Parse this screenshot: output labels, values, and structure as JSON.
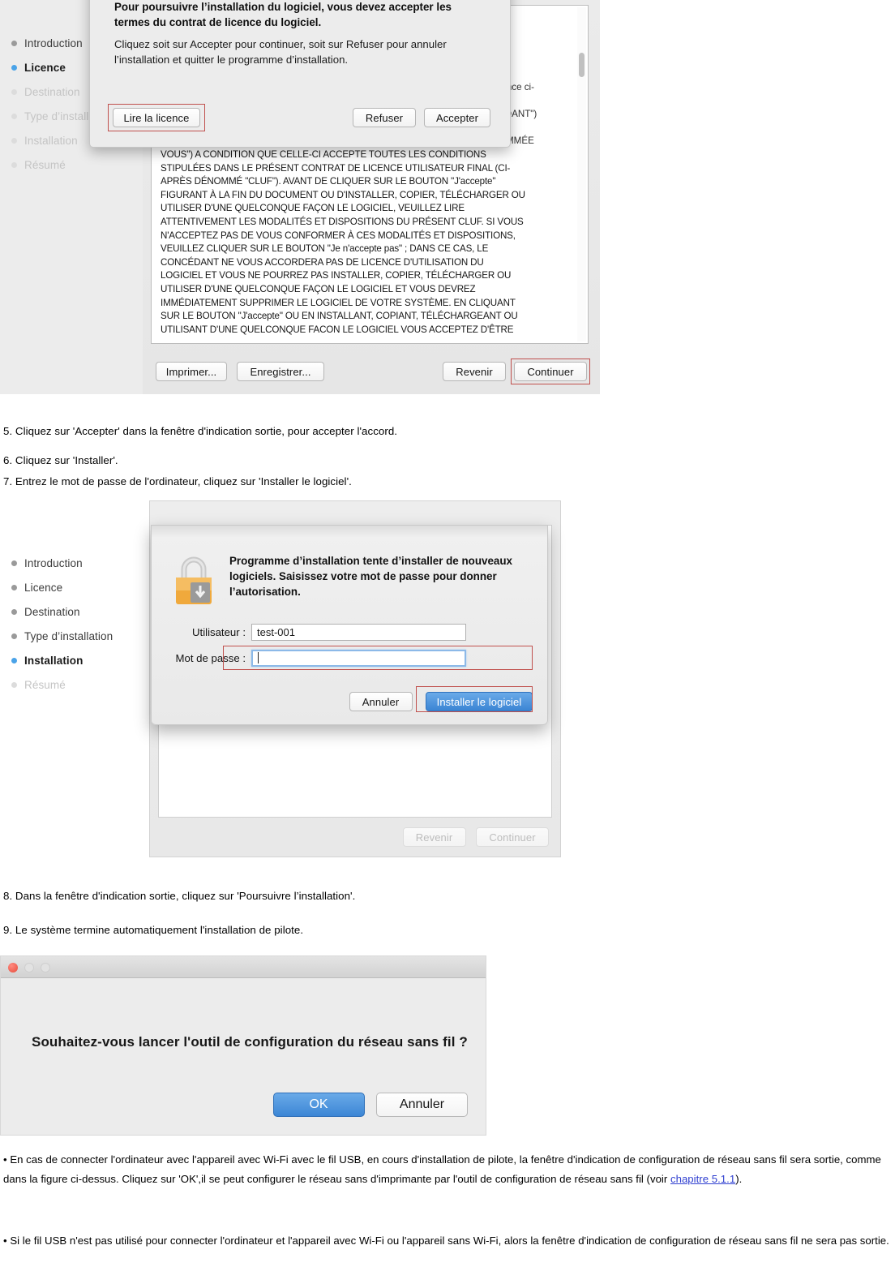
{
  "figure1": {
    "sidebar": [
      {
        "label": "Introduction",
        "state": "done"
      },
      {
        "label": "Licence",
        "state": "active"
      },
      {
        "label": "Destination",
        "state": "faded"
      },
      {
        "label": "Type d’installation",
        "state": "faded"
      },
      {
        "label": "Installation",
        "state": "faded"
      },
      {
        "label": "Résumé",
        "state": "faded"
      }
    ],
    "license_text": "VOUS\") A CONDITION QUE CELLE-CI ACCEPTE TOUTES LES CONDITIONS\nSTIPULÉES DANS LE PRÉSENT CONTRAT DE LICENCE UTILISATEUR FINAL (CI-\nAPRÈS DÉNOMMÉ \"CLUF\"). AVANT DE CLIQUER SUR LE BOUTON \"J'accepte\"\nFIGURANT À LA FIN DU DOCUMENT OU D'INSTALLER, COPIER, TÉLÉCHARGER OU\nUTILISER D'UNE QUELCONQUE FAÇON LE LOGICIEL, VEUILLEZ LIRE\nATTENTIVEMENT LES MODALITÉS ET DISPOSITIONS DU PRÉSENT CLUF. SI VOUS\nN'ACCEPTEZ PAS DE VOUS CONFORMER À CES MODALITÉS ET DISPOSITIONS,\nVEUILLEZ CLIQUER SUR LE BOUTON \"Je n'accepte pas\" ; DANS CE CAS, LE\nCONCÉDANT NE VOUS ACCORDERA PAS DE LICENCE D'UTILISATION DU\nLOGICIEL ET VOUS NE POURREZ PAS INSTALLER, COPIER, TÉLÉCHARGER OU\nUTILISER D'UNE QUELCONQUE FAÇON LE LOGICIEL ET VOUS DEVREZ\nIMMÉDIATEMENT SUPPRIMER LE LOGICIEL DE VOTRE SYSTÈME. EN CLIQUANT\nSUR LE BOUTON \"J'accepte\" OU EN INSTALLANT, COPIANT, TÉLÉCHARGEANT OU\nUTILISANT D'UNE QUELCONQUE FACON LE LOGICIEL VOUS ACCEPTEZ D'ÊTRE",
    "hidden_fragments": [
      "icence ci-",
      "ÉDANT\")",
      ";",
      "OMMÉE"
    ],
    "buttons": {
      "print": "Imprimer...",
      "save": "Enregistrer...",
      "back": "Revenir",
      "continue": "Continuer"
    },
    "sheet": {
      "title": "Pour poursuivre l’installation du logiciel, vous devez accepter les termes du contrat de licence du logiciel.",
      "body": "Cliquez soit sur Accepter pour continuer, soit sur Refuser pour annuler l’installation et quitter le programme d’installation.",
      "read_license": "Lire la licence",
      "refuse": "Refuser",
      "accept": "Accepter"
    }
  },
  "steps": {
    "step5": "5. Cliquez sur 'Accepter' dans la fenêtre d'indication sortie, pour accepter l'accord.",
    "step6": "6. Cliquez sur 'Installer'.",
    "step7": "7. Entrez le mot de passe de l'ordinateur, cliquez sur 'Installer le logiciel'.",
    "step8": "8. Dans la fenêtre d'indication sortie, cliquez sur 'Poursuivre l’installation'.",
    "step9": "9. Le système termine automatiquement l'installation de pilote."
  },
  "figure2": {
    "sidebar": [
      {
        "label": "Introduction",
        "state": "done"
      },
      {
        "label": "Licence",
        "state": "done"
      },
      {
        "label": "Destination",
        "state": "done"
      },
      {
        "label": "Type d’installation",
        "state": "done"
      },
      {
        "label": "Installation",
        "state": "active"
      },
      {
        "label": "Résumé",
        "state": "faded"
      }
    ],
    "buttons": {
      "back": "Revenir",
      "continue": "Continuer"
    },
    "sheet": {
      "title": "Programme d’installation tente d’installer de nouveaux logiciels. Saisissez votre mot de passe pour donner l’autorisation.",
      "user_label": "Utilisateur :",
      "user_value": "test-001",
      "password_label": "Mot de passe :",
      "password_value": "",
      "cancel": "Annuler",
      "install": "Installer le logiciel"
    }
  },
  "figure3": {
    "question": "Souhaitez-vous lancer l'outil de configuration du réseau sans fil ?",
    "ok": "OK",
    "cancel": "Annuler"
  },
  "notes": {
    "bullet1_part1": "• En cas de connecter l'ordinateur avec l'appareil avec Wi-Fi avec le fil USB, en cours d'installation de pilote, la fenêtre d'indication de configuration de réseau sans fil sera sortie, comme dans la figure ci-dessus. Cliquez sur 'OK',il se peut configurer le réseau sans d'imprimante par l'outil de configuration de réseau sans fil (voir ",
    "bullet1_link": "chapitre 5.1.1",
    "bullet1_part2": ").",
    "bullet2": "• Si le fil USB n'est pas utilisé pour connecter l'ordinateur et l'appareil avec Wi-Fi ou l'appareil sans Wi-Fi, alors la fenêtre d'indication de configuration de réseau sans fil ne sera pas sortie."
  },
  "colors": {
    "accent_blue": "#3b85d4",
    "annotation_red": "#c0504d",
    "link_blue": "#2f3fd0"
  }
}
